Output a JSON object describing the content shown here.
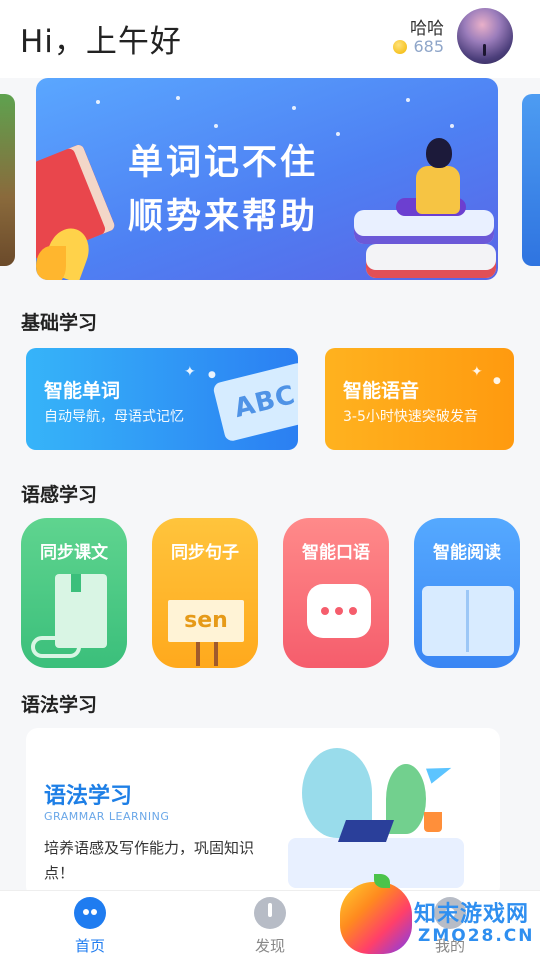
{
  "header": {
    "greeting": "Hi，上午好",
    "user_name": "哈哈",
    "coins": "685"
  },
  "banner": {
    "line1": "单词记不住",
    "line2": "顺势来帮助"
  },
  "basic": {
    "section_title": "基础学习",
    "cards": [
      {
        "title": "智能单词",
        "subtitle": "自动导航，母语式记忆",
        "art_text": "ABC"
      },
      {
        "title": "智能语音",
        "subtitle": "3-5小时快速突破发音"
      }
    ]
  },
  "sense": {
    "section_title": "语感学习",
    "tiles": [
      {
        "label": "同步课文"
      },
      {
        "label": "同步句子",
        "art_text": "sen"
      },
      {
        "label": "智能口语"
      },
      {
        "label": "智能阅读"
      }
    ]
  },
  "grammar": {
    "section_title": "语法学习",
    "card_title": "语法学习",
    "card_subtitle": "GRAMMAR LEARNING",
    "card_desc": "培养语感及写作能力，巩固知识点！"
  },
  "nav": {
    "items": [
      {
        "label": "首页",
        "icon": "robot-icon",
        "active": true
      },
      {
        "label": "发现",
        "icon": "compass-icon",
        "active": false
      },
      {
        "label": "我的",
        "icon": "user-icon",
        "active": false
      }
    ]
  },
  "watermark": {
    "name": "知末游戏网",
    "url": "ZMO28.CN"
  },
  "colors": {
    "primary": "#1f7cf0",
    "word_card": "#2b7ff2",
    "voice_card": "#ff9a0f",
    "tile_green": "#3bbf7b",
    "tile_yellow": "#ffa91d",
    "tile_red": "#f55d6c",
    "tile_blue": "#3a86f4"
  }
}
